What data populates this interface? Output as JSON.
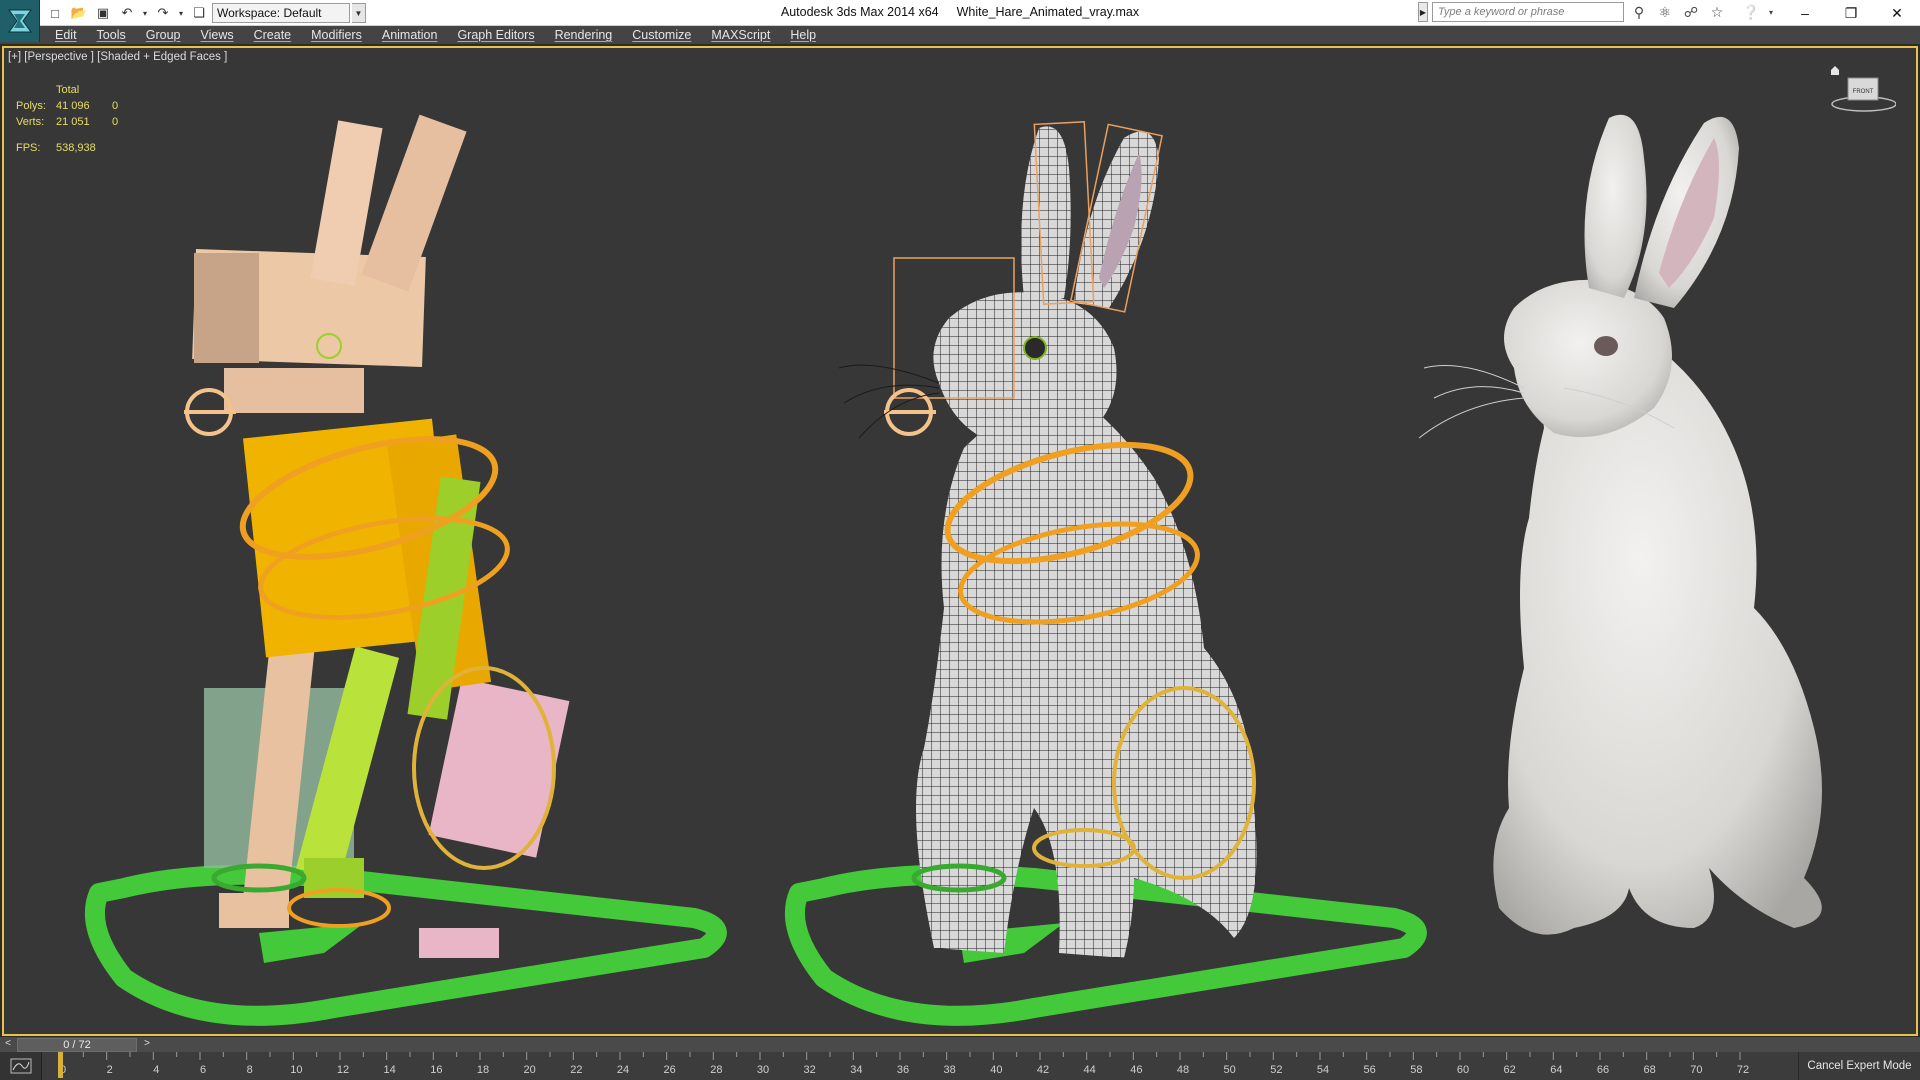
{
  "titlebar": {
    "app_name": "Autodesk 3ds Max  2014 x64",
    "file_name": "White_Hare_Animated_vray.max",
    "workspace": "Workspace: Default",
    "search_placeholder": "Type a keyword or phrase"
  },
  "menu": [
    "Edit",
    "Tools",
    "Group",
    "Views",
    "Create",
    "Modifiers",
    "Animation",
    "Graph Editors",
    "Rendering",
    "Customize",
    "MAXScript",
    "Help"
  ],
  "viewport": {
    "label": "[+] [Perspective ] [Shaded + Edged Faces ]",
    "stats": {
      "header": "Total",
      "polys_label": "Polys:",
      "polys_total": "41 096",
      "polys_sel": "0",
      "verts_label": "Verts:",
      "verts_total": "21 051",
      "verts_sel": "0",
      "fps_label": "FPS:",
      "fps_value": "538,938"
    },
    "viewcube_label": "FRONT",
    "colors": {
      "frame_active": "#e8c34a",
      "background": "#373737",
      "bone_orange": "#f0a020",
      "control_green": "#44c93a",
      "fur_white": "#e6e4e1"
    }
  },
  "timeline": {
    "frame_display": "0 / 72",
    "ticks": [
      "0",
      "2",
      "4",
      "6",
      "8",
      "10",
      "12",
      "14",
      "16",
      "18",
      "20",
      "22",
      "24",
      "26",
      "28",
      "30",
      "32",
      "34",
      "36",
      "38",
      "40",
      "42",
      "44",
      "46",
      "48",
      "50",
      "52",
      "54",
      "56",
      "58",
      "60",
      "62",
      "64",
      "66",
      "68",
      "70",
      "72"
    ],
    "cancel_expert": "Cancel Expert Mode"
  },
  "icons": {
    "qa": [
      "new-file-icon",
      "open-file-icon",
      "save-icon",
      "undo-icon",
      "undo-dropdown-icon",
      "redo-icon",
      "redo-dropdown-icon",
      "project-folder-icon"
    ],
    "search_tools": [
      "binoculars-icon",
      "key-tool-icon",
      "communication-icon",
      "favorites-star-icon",
      "help-icon"
    ]
  }
}
